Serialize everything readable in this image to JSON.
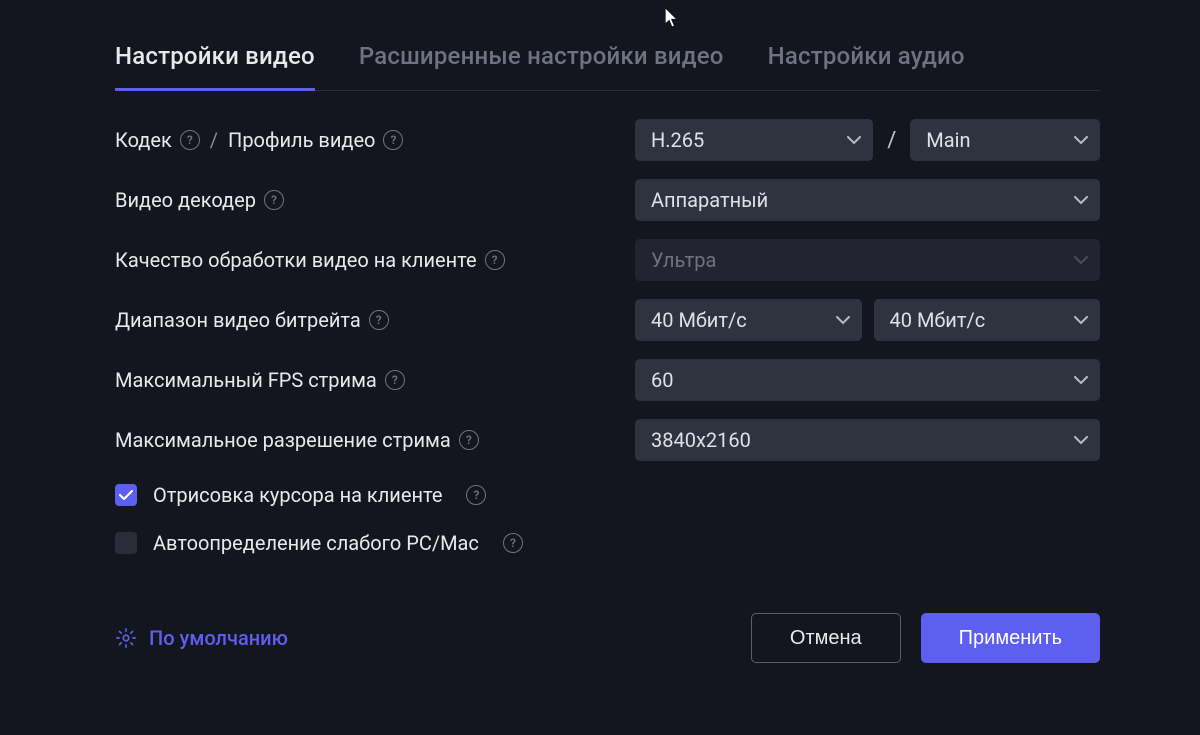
{
  "tabs": {
    "video": "Настройки видео",
    "advanced": "Расширенные настройки видео",
    "audio": "Настройки аудио"
  },
  "labels": {
    "codec": "Кодек",
    "sep": "/",
    "profile": "Профиль видео",
    "decoder": "Видео декодер",
    "quality": "Качество обработки видео на клиенте",
    "bitrate": "Диапазон видео битрейта",
    "fps": "Максимальный FPS стрима",
    "resolution": "Максимальное разрешение стрима"
  },
  "values": {
    "codec": "H.265",
    "profile": "Main",
    "decoder": "Аппаратный",
    "quality": "Ультра",
    "bitrate_min": "40 Мбит/с",
    "bitrate_max": "40 Мбит/с",
    "fps": "60",
    "resolution": "3840x2160"
  },
  "checkboxes": {
    "cursor": "Отрисовка курсора на клиенте",
    "weak_pc": "Автоопределение слабого PC/Mac"
  },
  "footer": {
    "defaults": "По умолчанию",
    "cancel": "Отмена",
    "apply": "Применить"
  },
  "icons": {
    "help_glyph": "?"
  }
}
